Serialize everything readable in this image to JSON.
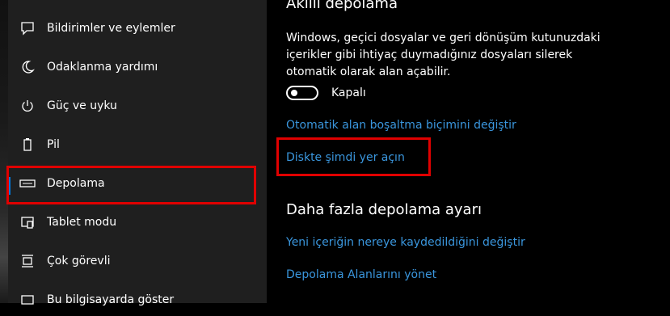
{
  "sidebar": {
    "items": [
      {
        "label": "Bildirimler ve eylemler",
        "icon": "message-icon"
      },
      {
        "label": "Odaklanma yardımı",
        "icon": "moon-icon"
      },
      {
        "label": "Güç ve uyku",
        "icon": "power-icon"
      },
      {
        "label": "Pil",
        "icon": "battery-icon"
      },
      {
        "label": "Depolama",
        "icon": "storage-icon",
        "selected": true
      },
      {
        "label": "Tablet modu",
        "icon": "tablet-icon"
      },
      {
        "label": "Çok görevli",
        "icon": "multitask-icon"
      },
      {
        "label": "Bu bilgisayarda göster",
        "icon": "project-icon"
      }
    ]
  },
  "main": {
    "smart_storage_title": "Akıllı depolama",
    "description": "Windows, geçici dosyalar ve geri dönüşüm kutunuzdaki içerikler gibi ihtiyaç duymadığınız dosyaları silerek otomatik olarak alan açabilir.",
    "toggle": {
      "state": "off",
      "label": "Kapalı"
    },
    "link_configure": "Otomatik alan boşaltma biçimini değiştir",
    "link_free_space": "Diskte şimdi yer açın",
    "more_settings_title": "Daha fazla depolama ayarı",
    "link_save_location": "Yeni içeriğin nereye kaydedildiğini değiştir",
    "link_manage_spaces": "Depolama Alanlarını yönet"
  },
  "colors": {
    "accent": "#0078d7",
    "link": "#3a96dd",
    "highlight": "#e00000",
    "sidebar_bg": "#1f1f1f",
    "main_bg": "#000000"
  }
}
